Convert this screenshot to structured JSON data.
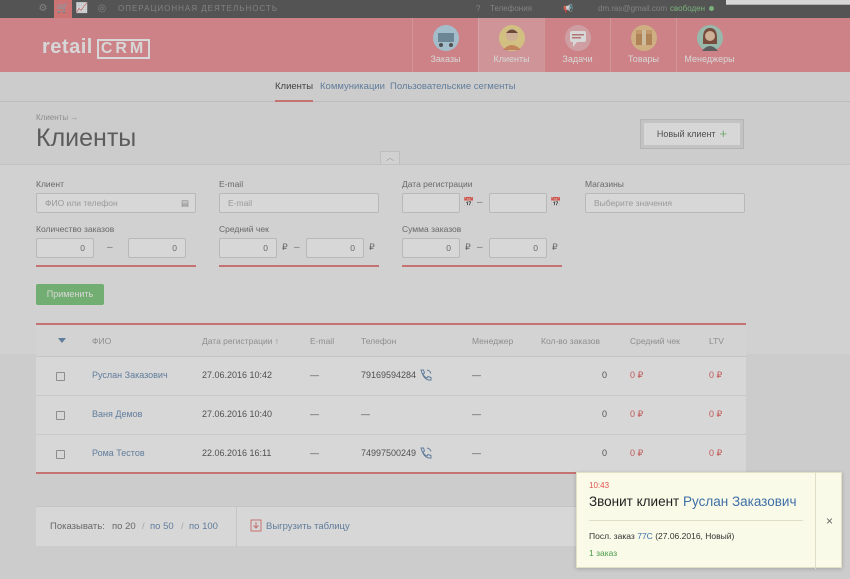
{
  "sysbar": {
    "ops_label": "ОПЕРАЦИОННАЯ ДЕЯТЕЛЬНОСТЬ",
    "telephony_label": "Телефония",
    "user_email": "dm.ras@gmail.com",
    "status": "свободен"
  },
  "header": {
    "logo_retail": "retail",
    "logo_crm": "CRM",
    "nav": [
      {
        "label": "Заказы"
      },
      {
        "label": "Клиенты"
      },
      {
        "label": "Задачи"
      },
      {
        "label": "Товары"
      },
      {
        "label": "Менеджеры"
      }
    ]
  },
  "subnav": {
    "tabs": [
      {
        "label": "Клиенты"
      },
      {
        "label": "Коммуникации"
      },
      {
        "label": "Пользовательские сегменты"
      }
    ]
  },
  "page": {
    "breadcrumb": "Клиенты →",
    "title": "Клиенты",
    "new_client_label": "Новый клиент",
    "new_client_plus": "+"
  },
  "filters": {
    "client_label": "Клиент",
    "client_placeholder": "ФИО или телефон",
    "email_label": "E-mail",
    "email_placeholder": "E-mail",
    "reg_date_label": "Дата регистрации",
    "shops_label": "Магазины",
    "shops_placeholder": "Выберите значения",
    "orders_count_label": "Количество заказов",
    "orders_from": "0",
    "orders_to": "0",
    "avg_check_label": "Средний чек",
    "avg_from": "0",
    "avg_to": "0",
    "sum_label": "Сумма заказов",
    "sum_from": "0",
    "sum_to": "0",
    "currency": "₽",
    "dash": "–",
    "apply_label": "Применить"
  },
  "table": {
    "headers": {
      "name": "ФИО",
      "reg_date": "Дата регистрации ↑",
      "email": "E-mail",
      "phone": "Телефон",
      "manager": "Менеджер",
      "orders": "Кол-во заказов",
      "avg": "Средний чек",
      "ltv": "LTV"
    },
    "rows": [
      {
        "name": "Руслан Заказович",
        "reg_date": "27.06.2016 10:42",
        "email": "—",
        "phone": "79169594284",
        "manager": "—",
        "orders": "0",
        "avg": "0 ₽",
        "ltv": "0 ₽"
      },
      {
        "name": "Ваня Демов",
        "reg_date": "27.06.2016 10:40",
        "email": "—",
        "phone": "—",
        "manager": "—",
        "orders": "0",
        "avg": "0 ₽",
        "ltv": "0 ₽"
      },
      {
        "name": "Рома Тестов",
        "reg_date": "22.06.2016 16:11",
        "email": "—",
        "phone": "74997500249",
        "manager": "—",
        "orders": "0",
        "avg": "0 ₽",
        "ltv": "0 ₽"
      }
    ]
  },
  "footer": {
    "show_label": "Показывать:",
    "per20": "по 20",
    "per50": "по 50",
    "per100": "по 100",
    "slash": "/",
    "export_label": "Выгрузить таблицу"
  },
  "popup": {
    "time": "10:43",
    "title_prefix": "Звонит клиент",
    "client_name": "Руслан Заказович",
    "last_order_prefix": "Посл. заказ",
    "last_order_num": "77C",
    "last_order_suffix": "(27.06.2016, Новый)",
    "orders_count": "1 заказ",
    "close": "×"
  },
  "colors": {
    "brand": "#f08a8f",
    "accent_red": "#e57373",
    "link": "#5b83ad",
    "apply_green": "#74c774"
  }
}
